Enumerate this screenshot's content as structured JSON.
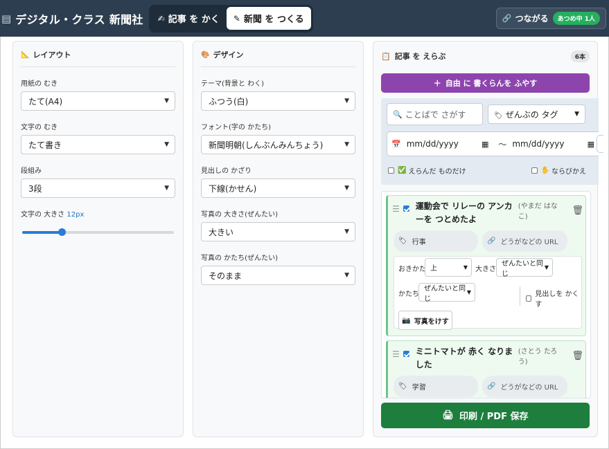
{
  "header": {
    "logo_icon": "newspaper-icon",
    "app_title": "デジタル・クラス 新聞社",
    "tabs": [
      {
        "icon": "✍",
        "label": "記事 を かく",
        "active": false
      },
      {
        "icon": "✎",
        "label": "新聞 を つくる",
        "active": true
      }
    ],
    "connect": {
      "icon": "🔗",
      "label": "つながる",
      "badge": "あつめ中 1人"
    }
  },
  "layout_panel": {
    "icon": "📐",
    "title": "レイアウト",
    "paper_label": "用紙の むき",
    "paper_value": "たて(A4)",
    "text_dir_label": "文字の むき",
    "text_dir_value": "たて書き",
    "columns_label": "段組み",
    "columns_value": "3段",
    "font_size_label": "文字の 大きさ",
    "font_size_value": "12px",
    "font_size_level": 0.26
  },
  "design_panel": {
    "icon": "🎨",
    "title": "デザイン",
    "theme_label": "テーマ(背景と わく)",
    "theme_value": "ふつう(白)",
    "font_label": "フォント(字の かたち)",
    "font_value": "新聞明朝(しんぶんみんちょう)",
    "heading_label": "見出しの かざり",
    "heading_value": "下線(かせん)",
    "photo_size_label": "写真の 大きさ(ぜんたい)",
    "photo_size_value": "大きい",
    "photo_shape_label": "写真の かたち(ぜんたい)",
    "photo_shape_value": "そのまま"
  },
  "articles_panel": {
    "icon": "📋",
    "title": "記事 を えらぶ",
    "count": "6本",
    "add_free_button": "自由 に 書くらんを ふやす",
    "add_free_icon": "＋",
    "search_placeholder": "ことばで さがす",
    "tag_filter": "ぜんぶの タグ",
    "date_from": "mm/dd/yyyy",
    "date_to": "mm/dd/yyyy",
    "date_sep": "～",
    "only_selected_label": "えらんだ ものだけ",
    "reorder_label": "ならびかえ",
    "articles": [
      {
        "title": "運動会で リレーの アンカーを つとめたよ",
        "author": "(やまだ はなこ)",
        "tag": "行事",
        "url_placeholder": "どうがなどの URL",
        "checked": true,
        "position_label": "おきかた",
        "position_value": "上",
        "size_label": "大きさ",
        "size_value": "ぜんたいと同じ",
        "shape_label": "かたち",
        "shape_value": "ぜんたいと同じ",
        "hide_heading_label": "見出しを かくす",
        "erase_photo_button": "写真をけす"
      },
      {
        "title": "ミニトマトが 赤く なりました",
        "author": "(さとう たろう)",
        "tag": "学習",
        "url_placeholder": "どうがなどの URL",
        "checked": true
      }
    ],
    "print_button": "印刷 / PDF 保存",
    "print_icon": "🖨"
  },
  "colors": {
    "header_bg": "#2c3e50",
    "accent_purple": "#8e44ad",
    "accent_green": "#1e7e3e",
    "live_badge": "#27ae60",
    "link_blue": "#1a73c8"
  }
}
